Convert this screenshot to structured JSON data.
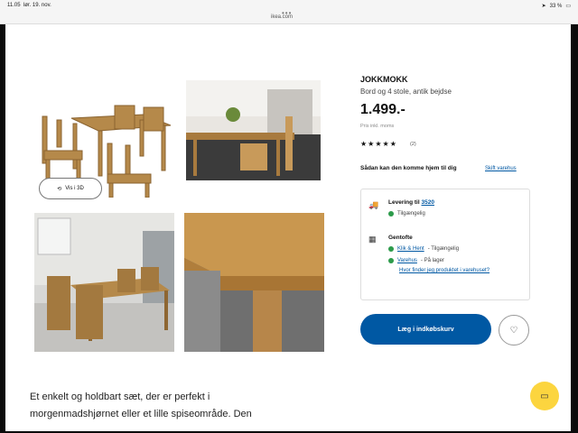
{
  "status_bar": {
    "time": "11.05",
    "date": "lør. 19. nov.",
    "battery": "33 %"
  },
  "browser": {
    "url": "ikea.com"
  },
  "gallery": {
    "view_3d_label": "Vis i 3D"
  },
  "product": {
    "name": "JOKKMOKK",
    "description": "Bord og 4 stole, antik bejdse",
    "price": "1.499.-",
    "price_note": "Pris inkl. moms",
    "rating_stars": 5,
    "review_count": "(2)"
  },
  "delivery": {
    "how_get_label": "Sådan kan den komme hjem til dig",
    "switch_store": "Skift varehus",
    "delivery_prefix": "Levering til",
    "delivery_zip": "3520",
    "delivery_status": "Tilgængelig",
    "store_name": "Gentofte",
    "clickcollect_label": "Klik & Hent",
    "clickcollect_status": "- Tilgængelig",
    "instore_label": "Varehus",
    "instore_status": "- På lager",
    "where_find": "Hvor finder jeg produktet i varehuset?"
  },
  "actions": {
    "add_to_cart": "Læg i indkøbskurv"
  },
  "description_text": "Et enkelt og holdbart sæt, der er perfekt i morgenmadshjørnet eller et lille spiseområde. Den",
  "colors": {
    "ikea_blue": "#0058a3",
    "ikea_yellow": "#fcd53f",
    "status_green": "#2d9b4b"
  }
}
